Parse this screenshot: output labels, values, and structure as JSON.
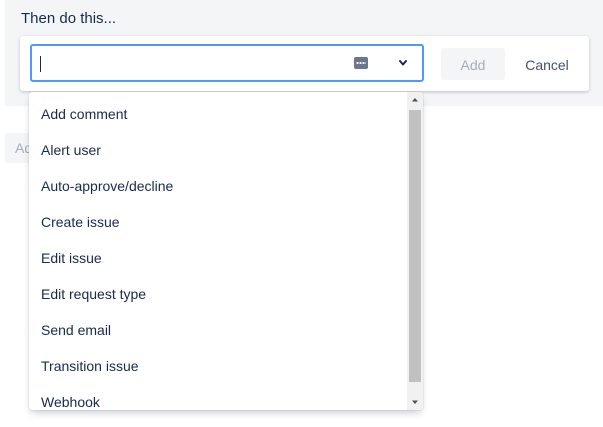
{
  "section": {
    "title": "Then do this..."
  },
  "action_select": {
    "value": "",
    "add_label": "Add",
    "cancel_label": "Cancel"
  },
  "behind_button": {
    "label": "Ad"
  },
  "dropdown": {
    "options": [
      {
        "label": "Add comment"
      },
      {
        "label": "Alert user"
      },
      {
        "label": "Auto-approve/decline"
      },
      {
        "label": "Create issue"
      },
      {
        "label": "Edit issue"
      },
      {
        "label": "Edit request type"
      },
      {
        "label": "Send email"
      },
      {
        "label": "Transition issue"
      },
      {
        "label": "Webhook"
      }
    ]
  },
  "icons": {
    "input_helper": "dots-icon",
    "expand": "chevron-down-icon",
    "scroll_up": "scroll-up-arrow-icon",
    "scroll_down": "scroll-down-arrow-icon"
  },
  "colors": {
    "focus_border": "#4c9aff",
    "panel_background": "#f4f5f7",
    "text_primary": "#172b4d",
    "disabled_text": "#a5adba"
  }
}
